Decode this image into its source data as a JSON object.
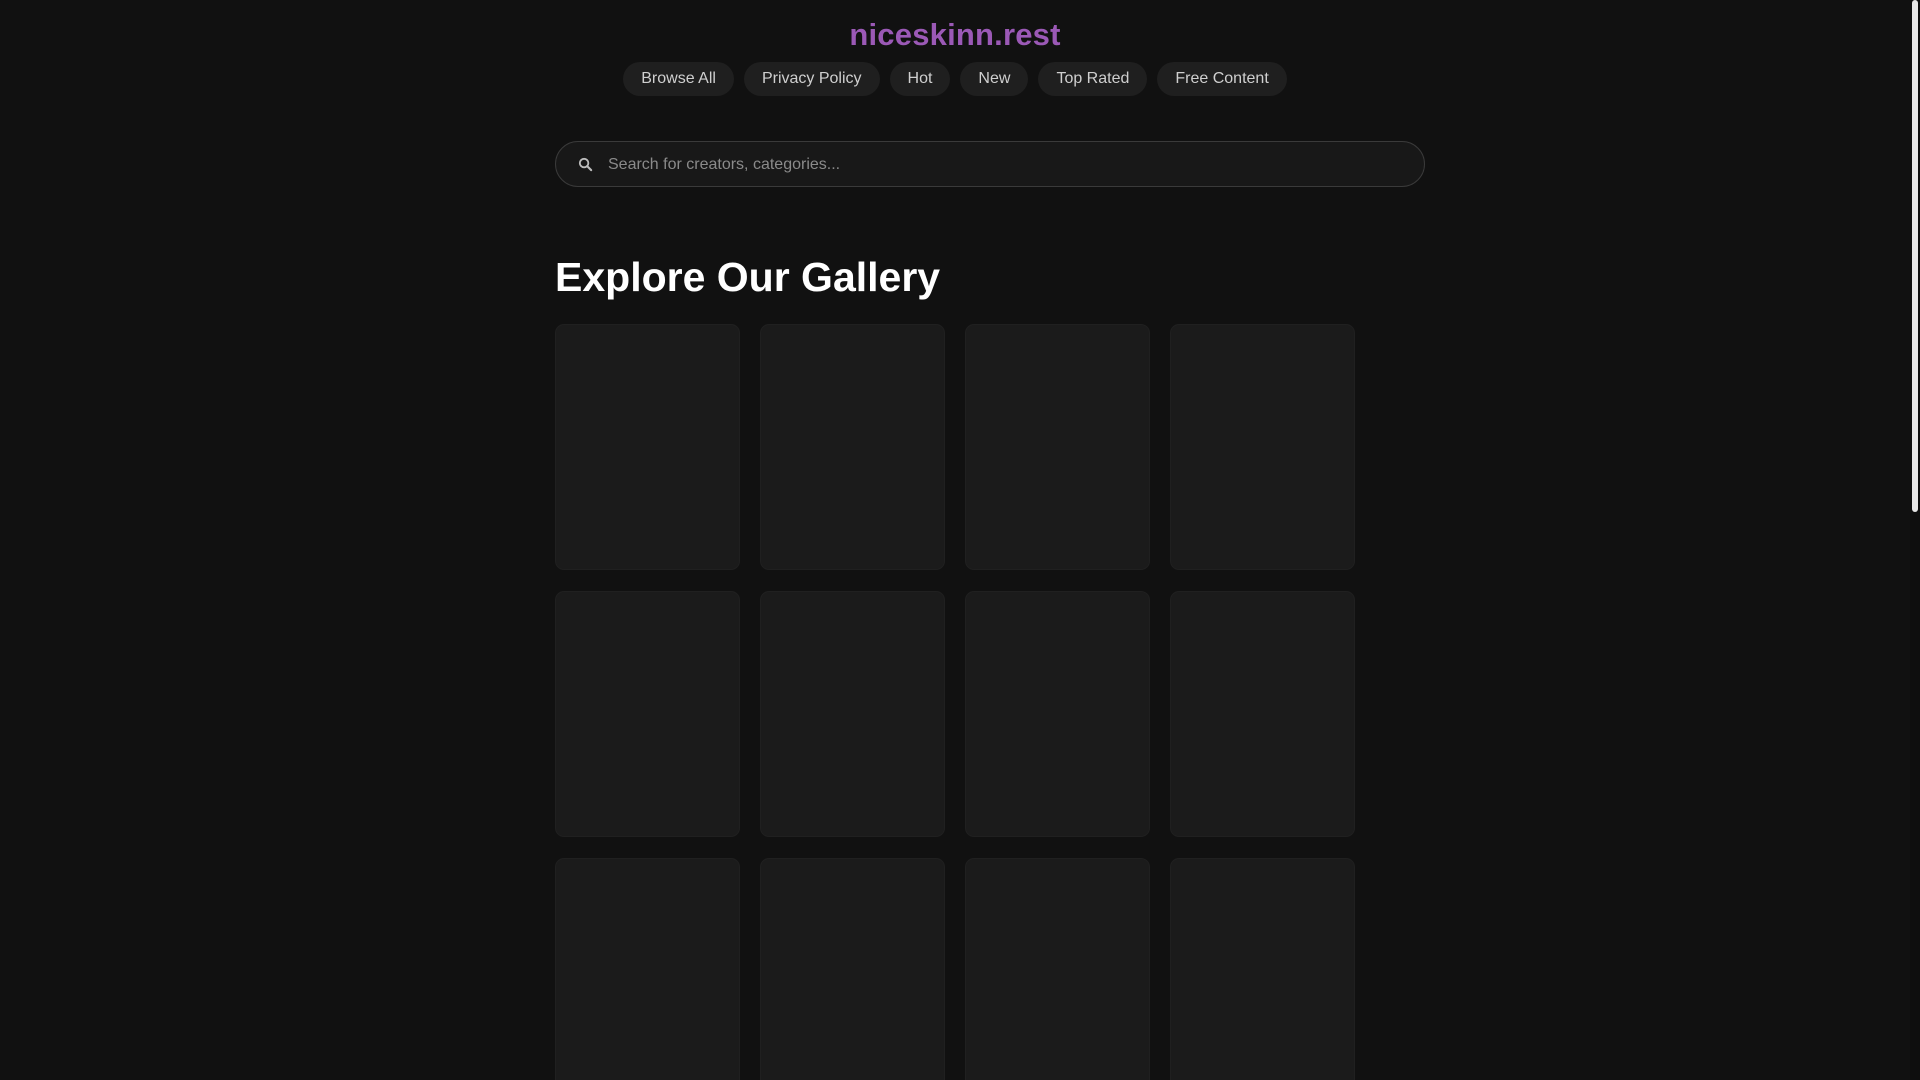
{
  "site": {
    "logo": "niceskinn.rest",
    "accent_color": "#9b59b6"
  },
  "nav": {
    "items": [
      {
        "label": "Browse All"
      },
      {
        "label": "Privacy Policy"
      },
      {
        "label": "Hot"
      },
      {
        "label": "New"
      },
      {
        "label": "Top Rated"
      },
      {
        "label": "Free Content"
      }
    ]
  },
  "search": {
    "icon": "search-icon",
    "placeholder": "Search for creators, categories...",
    "value": ""
  },
  "gallery": {
    "title": "Explore Our Gallery",
    "visible_cards": 12
  }
}
